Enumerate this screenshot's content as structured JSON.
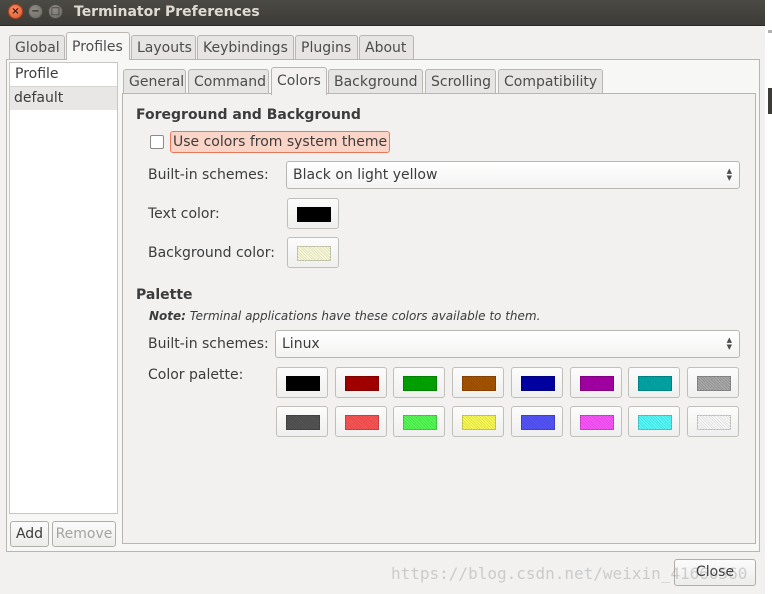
{
  "window": {
    "title": "Terminator Preferences",
    "close_glyph": "×",
    "minimize_glyph": "−",
    "maximize_glyph": "□"
  },
  "top_tabs": [
    {
      "label": "Global"
    },
    {
      "label": "Profiles",
      "active": true
    },
    {
      "label": "Layouts"
    },
    {
      "label": "Keybindings"
    },
    {
      "label": "Plugins"
    },
    {
      "label": "About"
    }
  ],
  "profiles": {
    "header": "Profile",
    "items": [
      "default"
    ],
    "add_label": "Add",
    "remove_label": "Remove"
  },
  "sub_tabs": [
    {
      "label": "General"
    },
    {
      "label": "Command"
    },
    {
      "label": "Colors",
      "active": true
    },
    {
      "label": "Background"
    },
    {
      "label": "Scrolling"
    },
    {
      "label": "Compatibility"
    }
  ],
  "fg_bg": {
    "title": "Foreground and Background",
    "system_theme_label": "Use colors from system theme",
    "system_theme_checked": false,
    "schemes_label": "Built-in schemes:",
    "scheme_value": "Black on light yellow",
    "text_color_label": "Text color:",
    "text_color": "#000000",
    "bg_color_label": "Background color:",
    "bg_color": "#ffffdd"
  },
  "palette": {
    "title": "Palette",
    "note_bold": "Note:",
    "note_text": " Terminal applications have these colors available to them.",
    "schemes_label": "Built-in schemes:",
    "scheme_value": "Linux",
    "palette_label": "Color palette:",
    "colors": [
      "#000000",
      "#aa0000",
      "#00aa00",
      "#aa5500",
      "#0000aa",
      "#aa00aa",
      "#00aaaa",
      "#aaaaaa",
      "#555555",
      "#ff5555",
      "#55ff55",
      "#ffff55",
      "#5555ff",
      "#ff55ff",
      "#55ffff",
      "#ffffff"
    ]
  },
  "footer": {
    "close_label": "Close",
    "watermark": "https://blog.csdn.net/weixin_41660560"
  }
}
